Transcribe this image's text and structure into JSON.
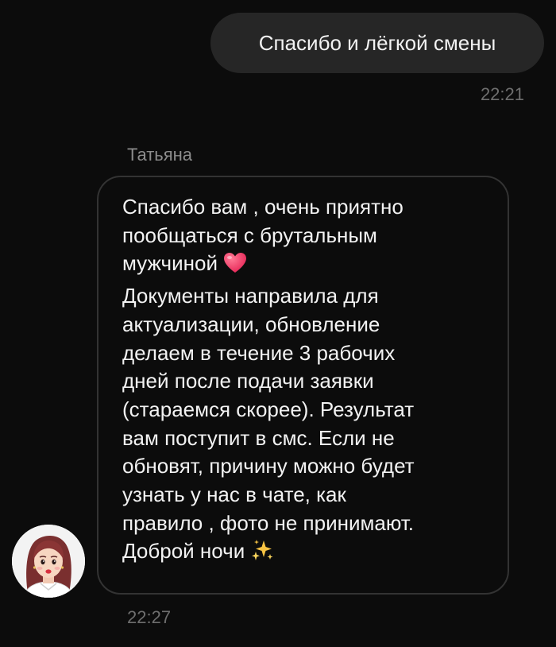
{
  "chat": {
    "outgoing": {
      "text": "Спасибо и лёгкой смены",
      "time": "22:21"
    },
    "incoming": {
      "sender": "Татьяна",
      "lines": [
        "Спасибо вам , очень приятно",
        "пообщаться с  брутальным",
        "мужчиной",
        "Документы направила для",
        "актуализации,  обновление",
        "делаем в течение 3 рабочих",
        "дней после подачи заявки",
        "(стараемся скорее). Результат",
        "вам поступит в смс. Если не",
        "обновят,  причину можно будет",
        "узнать у нас в чате, как",
        "правило , фото не принимают.",
        "Доброй ночи"
      ],
      "time": "22:27",
      "emoji_icons": [
        "heart-emoji",
        "sparkles-emoji"
      ]
    }
  },
  "colors": {
    "background": "#0c0c0c",
    "outgoing_bubble": "#262626",
    "incoming_border": "#333333",
    "text": "#f2f2f2",
    "timestamp": "#6e6e6e",
    "sender": "#8c8c8c",
    "heart": "#f2476e",
    "sparkles": "#f6c343"
  }
}
